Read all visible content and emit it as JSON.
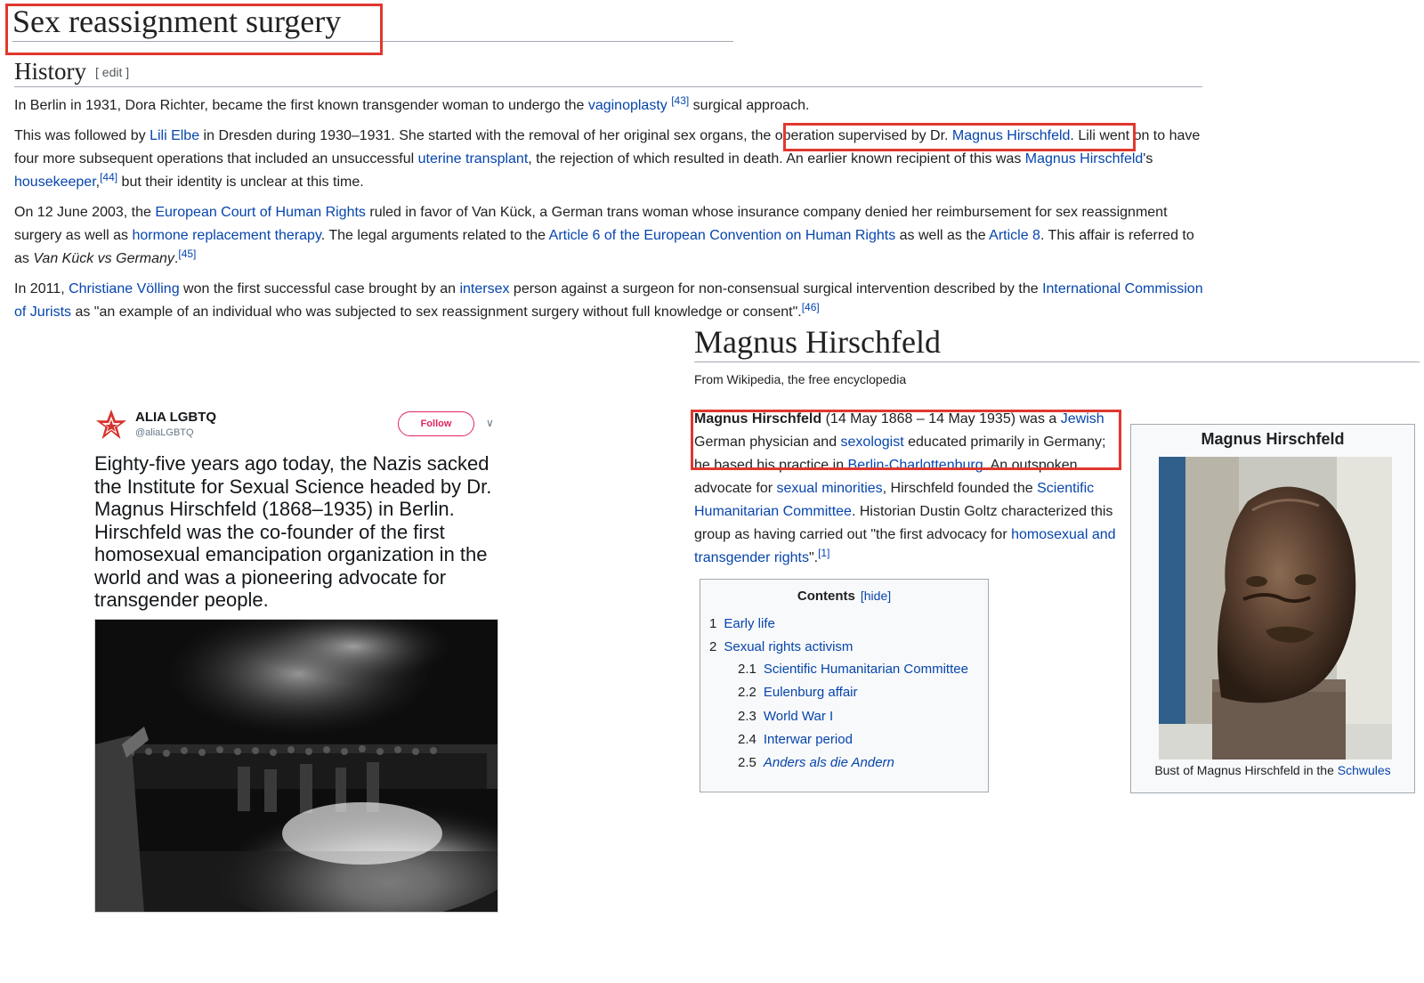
{
  "top_article": {
    "title": "Sex reassignment surgery",
    "section_heading": "History",
    "section_edit": "[ edit ]",
    "p1": {
      "t1": "In Berlin in 1931, Dora Richter, became the first known transgender woman to undergo the ",
      "l1": "vaginoplasty",
      "r1": "[43]",
      "t2": " surgical approach."
    },
    "p2": {
      "t1": "This was followed by ",
      "l1": "Lili Elbe",
      "t2": " in Dresden during 1930–1931. She started with the removal of her original sex organs, ",
      "t3": "the operation supervised by Dr. ",
      "l2": "Magnus Hirschfeld",
      "t4": ". ",
      "t5": "Lili went on to have four more subsequent operations that included an unsuccessful ",
      "l3": "uterine transplant",
      "t6": ", the rejection of which resulted in death. An earlier known recipient of this was ",
      "l4": "Magnus Hirschfeld",
      "t7": "'s ",
      "l5": "housekeeper",
      "t8": ",",
      "r1": "[44]",
      "t9": " but their identity is unclear at this time."
    },
    "p3": {
      "t1": "On 12 June 2003, the ",
      "l1": "European Court of Human Rights",
      "t2": " ruled in favor of Van Kück, a German trans woman whose insurance company denied her reimbursement for sex reassignment surgery as well as ",
      "l2": "hormone replacement therapy",
      "t3": ". The legal arguments related to the ",
      "l3": "Article 6 of the European Convention on Human Rights",
      "t4": " as well as the ",
      "l4": "Article 8",
      "t5": ". This affair is referred to as ",
      "i1": "Van Kück vs Germany",
      "t6": ".",
      "r1": "[45]"
    },
    "p4": {
      "t1": "In 2011, ",
      "l1": "Christiane Völling",
      "t2": " won the first successful case brought by an ",
      "l2": "intersex",
      "t3": " person against a surgeon for non-consensual surgical intervention described by the ",
      "l3": "International Commission of Jurists",
      "t4": " as \"an example of an individual who was subjected to sex reassignment surgery without full knowledge or consent\".",
      "r1": "[46]"
    }
  },
  "tweet": {
    "account_name": "ALIA LGBTQ",
    "handle": "@aliaLGBTQ",
    "follow_label": "Follow",
    "text": "Eighty-five years ago today, the Nazis sacked the Institute for Sexual Science headed by Dr. Magnus Hirschfeld (1868–1935) in Berlin. Hirschfeld was the co-founder of the first homosexual emancipation organization in the world and was a pioneering advocate for transgender people.",
    "photo_icon": "book-burning-photo"
  },
  "right_article": {
    "title": "Magnus Hirschfeld",
    "subtitle": "From Wikipedia, the free encyclopedia",
    "para": {
      "b1": "Magnus Hirschfeld",
      "t1": " (14 May 1868 – 14 May 1935) was a ",
      "l1": "Jewish",
      "t2": " German physician and ",
      "l2": "sexologist",
      "t3": " educated primarily in Germany; he based his practice in ",
      "l3": "Berlin-Charlottenburg",
      "t4": ". An outspoken advocate for ",
      "l4": "sexual minorities",
      "t5": ", Hirschfeld founded the ",
      "l5": "Scientific Humanitarian Committee",
      "t6": ". Historian Dustin Goltz characterized this group as having carried out \"the first advocacy for ",
      "l6": "homosexual and transgender rights",
      "t7": "\".",
      "r1": "[1]"
    },
    "toc": {
      "title": "Contents",
      "hide": "[hide]",
      "items": [
        {
          "num": "1",
          "label": "Early life"
        },
        {
          "num": "2",
          "label": "Sexual rights activism"
        },
        {
          "num": "2.1",
          "label": "Scientific Humanitarian Committee"
        },
        {
          "num": "2.2",
          "label": "Eulenburg affair"
        },
        {
          "num": "2.3",
          "label": "World War I"
        },
        {
          "num": "2.4",
          "label": "Interwar period"
        },
        {
          "num": "2.5",
          "label": "Anders als die Andern"
        }
      ]
    },
    "infobox": {
      "title": "Magnus Hirschfeld",
      "caption_text": "Bust of Magnus Hirschfeld in the ",
      "caption_link": "Schwules",
      "image_icon": "bronze-bust-photo"
    }
  },
  "colors": {
    "link": "#0645ad",
    "highlight_box": "#e0382f",
    "follow": "#e0245e"
  }
}
